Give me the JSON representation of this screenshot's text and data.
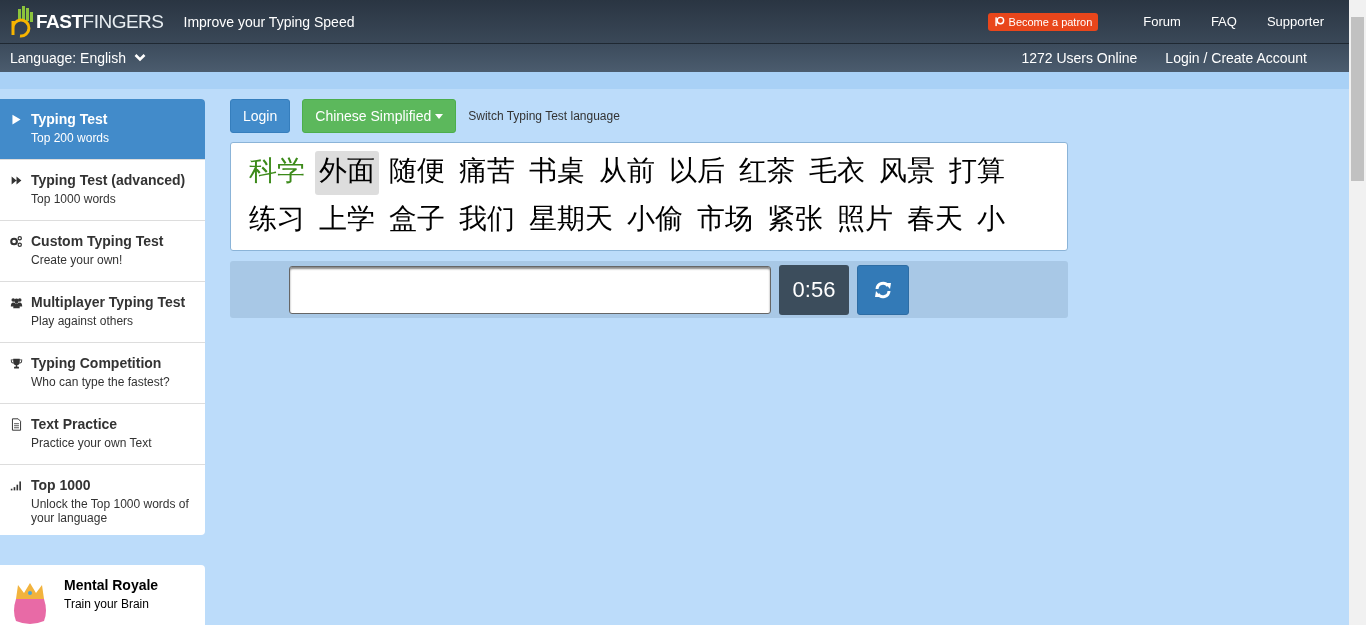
{
  "header": {
    "logo": "**FAST**FINGERS",
    "tagline": "Improve your Typing Speed",
    "patron_button": "Become a patron",
    "nav": [
      "Forum",
      "FAQ",
      "Supporter"
    ]
  },
  "subheader": {
    "language": "Language: English",
    "users_online": "1272 Users Online",
    "account_link": "Login / Create Account"
  },
  "sidebar": {
    "items": [
      {
        "kind": "play",
        "title": "Typing Test",
        "subtitle": "Top 200 words",
        "selected": true
      },
      {
        "kind": "fastforward",
        "title": "Typing Test (advanced)",
        "subtitle": "Top 1000 words",
        "selected": false
      },
      {
        "kind": "custom",
        "title": "Custom Typing Test",
        "subtitle": "Create your own!",
        "selected": false
      },
      {
        "kind": "multiplayer",
        "title": "Multiplayer Typing Test",
        "subtitle": "Play against others",
        "selected": false
      },
      {
        "kind": "competition",
        "title": "Typing Competition",
        "subtitle": "Who can type the fastest?",
        "selected": false
      },
      {
        "kind": "practice",
        "title": "Text Practice",
        "subtitle": "Practice your own Text",
        "selected": false
      },
      {
        "kind": "top",
        "title": "Top 1000",
        "subtitle": "Unlock the Top 1000 words of your language",
        "selected": false
      }
    ],
    "promo": {
      "title": "Mental Royale",
      "subtitle": "Train your Brain"
    }
  },
  "toolbar": {
    "login_button": "Login",
    "language_dropdown": "Chinese Simplified",
    "hint": "Switch Typing Test language"
  },
  "words": [
    {
      "text": "科学",
      "correct": true,
      "selected": false
    },
    {
      "text": "外面",
      "correct": false,
      "selected": true
    },
    {
      "text": "随便",
      "correct": false,
      "selected": false
    },
    {
      "text": "痛苦",
      "correct": false,
      "selected": false
    },
    {
      "text": "书桌",
      "correct": false,
      "selected": false
    },
    {
      "text": "从前",
      "correct": false,
      "selected": false
    },
    {
      "text": "以后",
      "correct": false,
      "selected": false
    },
    {
      "text": "红茶",
      "correct": false,
      "selected": false
    },
    {
      "text": "毛衣",
      "correct": false,
      "selected": false
    },
    {
      "text": "风景",
      "correct": false,
      "selected": false
    },
    {
      "text": "打算",
      "correct": false,
      "selected": false
    },
    {
      "text": "练习",
      "correct": false,
      "selected": false
    },
    {
      "text": "上学",
      "correct": false,
      "selected": false
    },
    {
      "text": "盒子",
      "correct": false,
      "selected": false
    },
    {
      "text": "我们",
      "correct": false,
      "selected": false
    },
    {
      "text": "星期天",
      "correct": false,
      "selected": false
    },
    {
      "text": "小偷",
      "correct": false,
      "selected": false
    },
    {
      "text": "市场",
      "correct": false,
      "selected": false
    },
    {
      "text": "紧张",
      "correct": false,
      "selected": false
    },
    {
      "text": "照片",
      "correct": false,
      "selected": false
    },
    {
      "text": "春天",
      "correct": false,
      "selected": false
    },
    {
      "text": "小",
      "correct": false,
      "selected": false
    }
  ],
  "input_row": {
    "timer": "0:56"
  }
}
